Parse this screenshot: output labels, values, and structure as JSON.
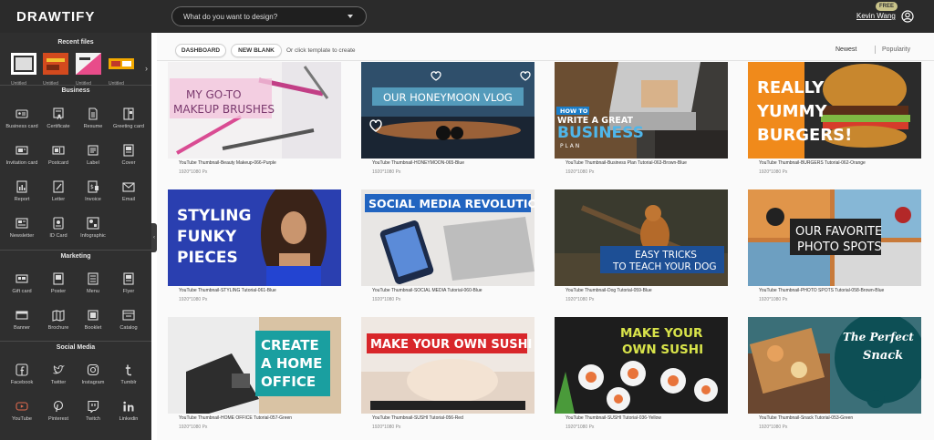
{
  "app": {
    "logo": "DRAWTIFY",
    "search_placeholder": "What do you want to design?",
    "badge": "FREE",
    "username": "Kevin Wang"
  },
  "sidebar": {
    "recent_title": "Recent files",
    "recent_items": [
      "Untitled",
      "Untitled",
      "Untitled",
      "Untitled"
    ],
    "sections": [
      {
        "title": "Business",
        "items": [
          "Business card",
          "Certificate",
          "Resume",
          "Greeting card",
          "Invitation card",
          "Postcard",
          "Label",
          "Cover",
          "Report",
          "Letter",
          "Invoice",
          "Email",
          "Newsletter",
          "ID Card",
          "Infographic"
        ]
      },
      {
        "title": "Marketing",
        "items": [
          "Gift card",
          "Poster",
          "Menu",
          "Flyer",
          "Banner",
          "Brochure",
          "Booklet",
          "Catalog"
        ]
      },
      {
        "title": "Social Media",
        "items": [
          "Facebook",
          "Twitter",
          "Instagram",
          "Tumblr",
          "YouTube",
          "Pinterest",
          "Twitch",
          "Linkedin"
        ]
      }
    ]
  },
  "main": {
    "buttons": {
      "dashboard": "DASHBOARD",
      "new_blank": "NEW BLANK"
    },
    "hint": "Or click template to create",
    "sort": {
      "newest": "Newest",
      "popularity": "Popularity"
    },
    "templates": [
      {
        "title": "YouTube Thumbnail-Beauty Makeup-066-Purple",
        "dims": "1920*1080 Px",
        "headline": [
          "MY GO-TO",
          "MAKEUP BRUSHES"
        ]
      },
      {
        "title": "YouTube Thumbnail-HONEYMOON-065-Blue",
        "dims": "1920*1080 Px",
        "headline": [
          "OUR HONEYMOON VLOG"
        ]
      },
      {
        "title": "YouTube Thumbnail-Business Plan Tutorial-063-Brown-Blue",
        "dims": "1920*1080 Px",
        "headline": [
          "HOW TO",
          "WRITE A GREAT",
          "BUSINESS",
          "P L A N"
        ]
      },
      {
        "title": "YouTube Thumbnail-BURGERS Tutorial-062-Orange",
        "dims": "1920*1080 Px",
        "headline": [
          "REALLY",
          "YUMMY",
          "BURGERS!"
        ]
      },
      {
        "title": "YouTube Thumbnail-STYLING Tutorial-061-Blue",
        "dims": "1920*1080 Px",
        "headline": [
          "STYLING",
          "FUNKY",
          "PIECES"
        ]
      },
      {
        "title": "YouTube Thumbnail-SOCIAL MEDIA Tutorial-060-Blue",
        "dims": "1920*1080 Px",
        "headline": [
          "SOCIAL MEDIA REVOLUTION"
        ]
      },
      {
        "title": "YouTube Thumbnail-Dog Tutorial-059-Blue",
        "dims": "1920*1080 Px",
        "headline": [
          "EASY TRICKS",
          "TO TEACH YOUR DOG"
        ]
      },
      {
        "title": "YouTube Thumbnail-PHOTO SPOTS Tutorial-058-Brown-Blue",
        "dims": "1920*1080 Px",
        "headline": [
          "OUR FAVORITE",
          "PHOTO SPOTS"
        ]
      },
      {
        "title": "YouTube Thumbnail-HOME OFFICE Tutorial-057-Green",
        "dims": "1920*1080 Px",
        "headline": [
          "CREATE",
          "A HOME",
          "OFFICE"
        ]
      },
      {
        "title": "YouTube Thumbnail-SUSHI Tutorial-056-Red",
        "dims": "1920*1080 Px",
        "headline": [
          "MAKE YOUR OWN SUSHI"
        ]
      },
      {
        "title": "YouTube Thumbnail-SUSHI Tutorial-036-Yellow",
        "dims": "1920*1080 Px",
        "headline": [
          "MAKE YOUR",
          "OWN SUSHI"
        ]
      },
      {
        "title": "YouTube Thumbnail-Snack Tutorial-053-Green",
        "dims": "1920*1080 Px",
        "headline": [
          "The Perfect",
          "Snack"
        ]
      }
    ]
  }
}
